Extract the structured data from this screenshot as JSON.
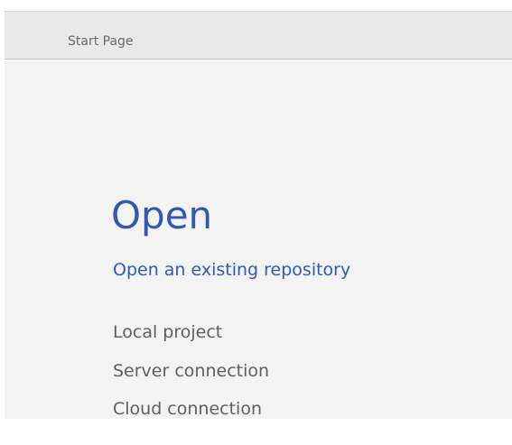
{
  "tab": {
    "label": "Start Page"
  },
  "open_section": {
    "title": "Open",
    "subtitle": "Open an existing repository",
    "links": [
      "Local project",
      "Server connection",
      "Cloud connection"
    ]
  },
  "colors": {
    "accent": "#2f59b3",
    "link_text": "#5f5f5f",
    "tab_background": "#e9e9e9",
    "content_background": "#f3f3f3"
  }
}
